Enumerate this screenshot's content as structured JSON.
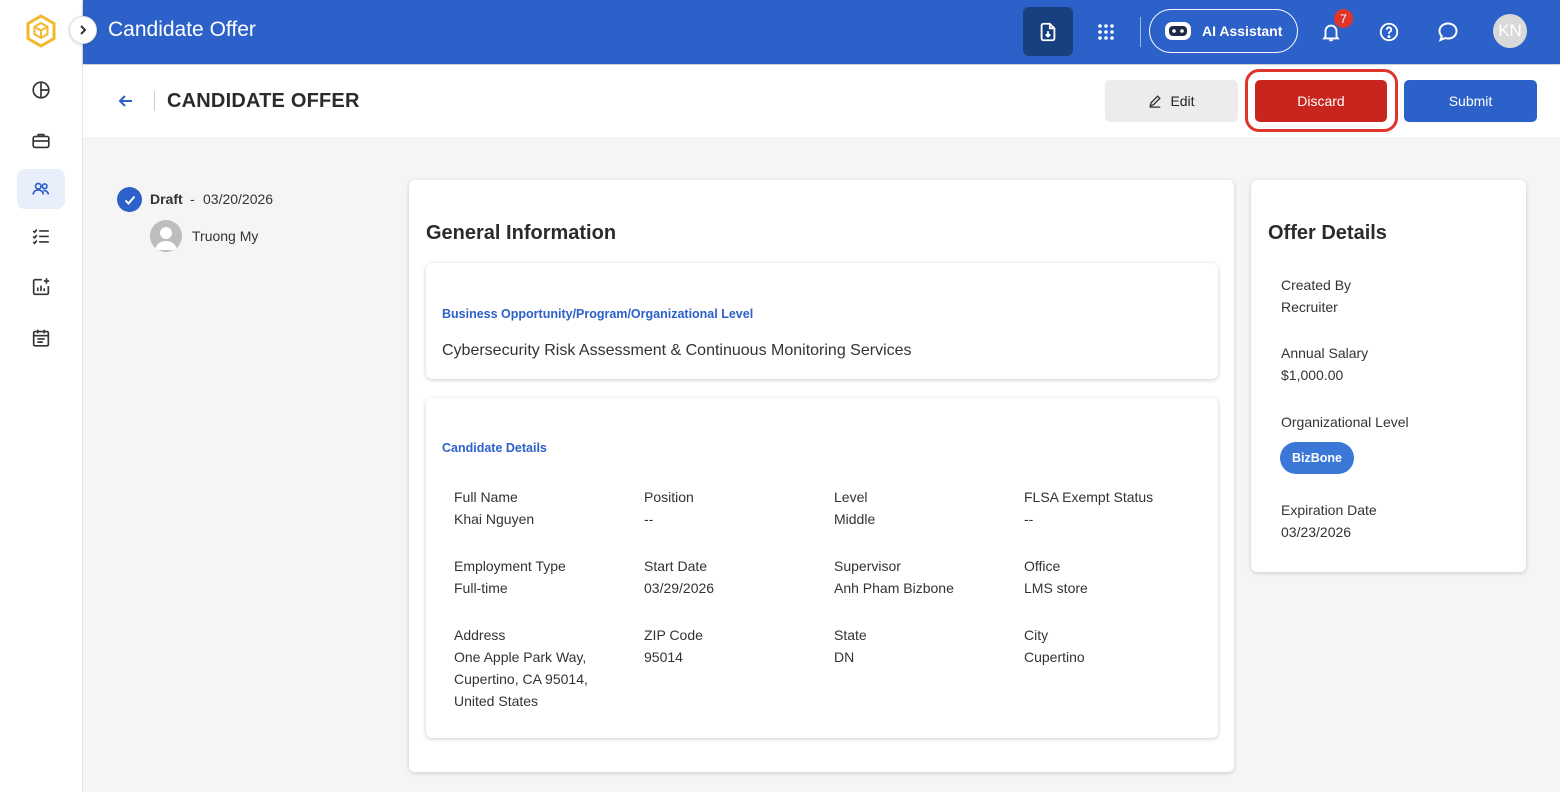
{
  "topbar": {
    "title": "Candidate Offer",
    "ai_assistant_label": "AI Assistant",
    "notification_count": "7",
    "user_initials": "KN"
  },
  "header": {
    "title": "CANDIDATE OFFER",
    "edit_label": "Edit",
    "discard_label": "Discard",
    "submit_label": "Submit"
  },
  "timeline": {
    "status": "Draft",
    "separator": "-",
    "date": "03/20/2026",
    "user": "Truong My"
  },
  "general": {
    "title": "General Information",
    "business_label": "Business Opportunity/Program/Organizational Level",
    "business_value": "Cybersecurity Risk Assessment & Continuous Monitoring Services",
    "candidate_label": "Candidate Details",
    "fields": [
      {
        "label": "Full Name",
        "value": "Khai Nguyen"
      },
      {
        "label": "Position",
        "value": "--"
      },
      {
        "label": "Level",
        "value": "Middle"
      },
      {
        "label": "FLSA Exempt Status",
        "value": "--"
      },
      {
        "label": "Employment Type",
        "value": "Full-time"
      },
      {
        "label": "Start Date",
        "value": "03/29/2026"
      },
      {
        "label": "Supervisor",
        "value": "Anh Pham Bizbone"
      },
      {
        "label": "Office",
        "value": "LMS store"
      },
      {
        "label": "Address",
        "value": "One Apple Park Way, Cupertino, CA 95014, United States"
      },
      {
        "label": "ZIP Code",
        "value": "95014"
      },
      {
        "label": "State",
        "value": "DN"
      },
      {
        "label": "City",
        "value": "Cupertino"
      }
    ]
  },
  "offer": {
    "title": "Offer Details",
    "created_by_label": "Created By",
    "created_by_value": "Recruiter",
    "salary_label": "Annual Salary",
    "salary_value": "$1,000.00",
    "org_level_label": "Organizational Level",
    "org_level_value": "BizBone",
    "expiration_label": "Expiration Date",
    "expiration_value": "03/23/2026"
  },
  "colors": {
    "primary": "#2c61c9",
    "discard": "#c9251f",
    "highlight": "#e0352b"
  },
  "icons": {
    "sidebar": [
      "dashboard-icon",
      "briefcase-icon",
      "users-icon",
      "checklist-icon",
      "report-add-icon",
      "calendar-icon"
    ],
    "topbar": [
      "download-icon",
      "apps-grid-icon",
      "robot-icon",
      "bell-icon",
      "help-icon",
      "chat-icon"
    ]
  }
}
